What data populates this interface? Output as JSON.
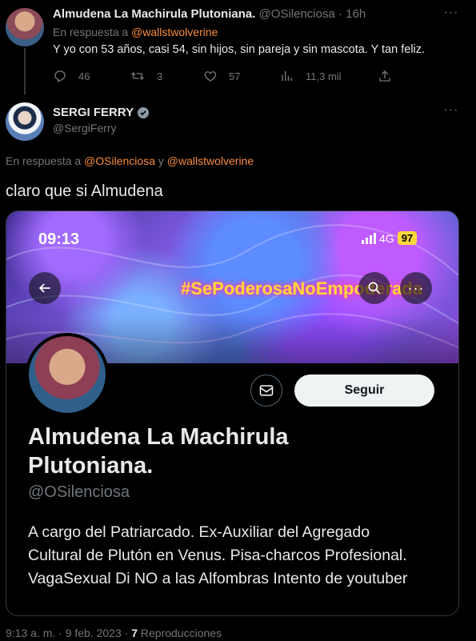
{
  "tweet1": {
    "author_name": "Almudena La Machirula Plutoniana.",
    "handle_time": "@OSilenciosa · 16h",
    "reply_prefix": "En respuesta a",
    "reply_to": "@wallstwolverine",
    "text": "Y yo con 53 años, casi 54, sin hijos, sin pareja y sin mascota. Y tan feliz.",
    "stats": {
      "replies": "46",
      "retweets": "3",
      "likes": "57",
      "views": "11,3 mil"
    }
  },
  "tweet2": {
    "author_name": "SERGI FERRY",
    "handle": "@SergiFerry",
    "reply_prefix": "En respuesta a",
    "reply_to_1": "@OSilenciosa",
    "reply_and": "y",
    "reply_to_2": "@wallstwolverine",
    "text": "claro que si Almudena",
    "footer": {
      "time_date": "9:13 a. m. · 9 feb. 2023 ·",
      "views_count": "7",
      "views_label": "Reproducciones"
    }
  },
  "screenshot_card": {
    "status_time": "09:13",
    "network": "4G",
    "battery": "97",
    "banner_hashtag": "#SePoderosaNoEmpoderada",
    "follow_label": "Seguir",
    "profile_name": "Almudena La Machirula Plutoniana.",
    "profile_handle": "@OSilenciosa",
    "bio": "A cargo del Patriarcado. Ex-Auxiliar del Agregado Cultural de Plutón en Venus. Pisa-charcos Profesional. VagaSexual Di NO a las Alfombras Intento de youtuber"
  },
  "colors": {
    "link": "#f98b3a",
    "muted": "#71767b",
    "text": "#e7e9ea",
    "battery": "#ffd83a"
  }
}
